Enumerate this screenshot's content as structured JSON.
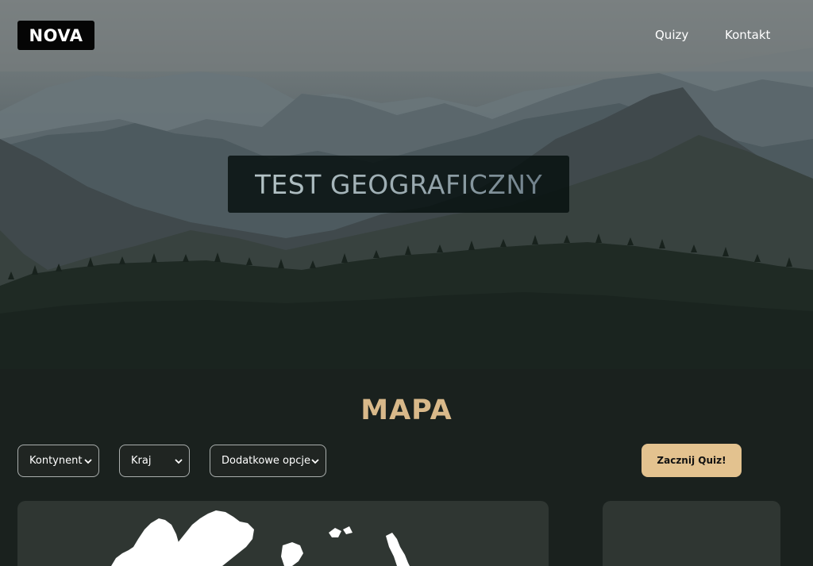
{
  "header": {
    "logo": "NOVA",
    "nav": [
      {
        "label": "Quizy"
      },
      {
        "label": "Kontakt"
      }
    ]
  },
  "hero": {
    "title": "TEST GEOGRAFICZNY"
  },
  "map_section": {
    "title": "MAPA",
    "selects": [
      {
        "selected": "Kontynent"
      },
      {
        "selected": "Kraj"
      },
      {
        "selected": "Dodatkowe opcje"
      }
    ],
    "start_button": "Zacznij Quiz!"
  },
  "colors": {
    "accent": "#e3c28f",
    "section_title": "#d9b98a",
    "background": "#1a211e",
    "panel": "#2f3632"
  },
  "icons": {
    "select_arrow": "chevron-down-icon"
  }
}
